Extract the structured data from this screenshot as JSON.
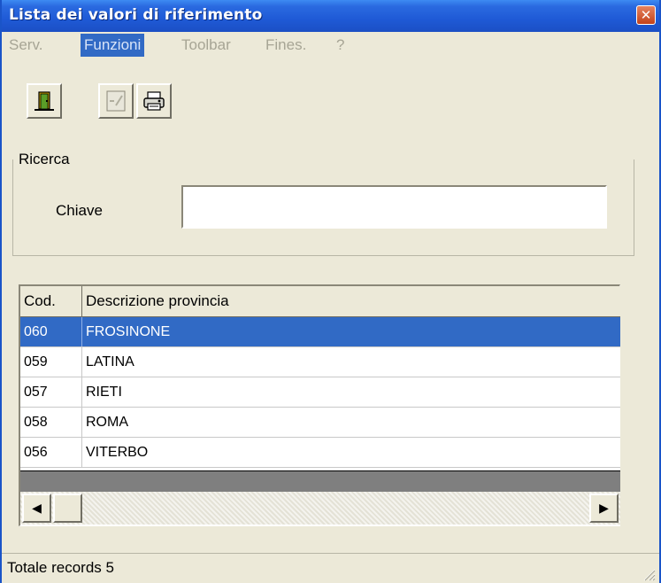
{
  "window": {
    "title": "Lista dei valori di riferimento",
    "close_glyph": "✕"
  },
  "menu": {
    "items": [
      {
        "label": "Serv.",
        "active": false
      },
      {
        "label": "Funzioni",
        "active": true
      },
      {
        "label": "Toolbar",
        "active": false
      },
      {
        "label": "Fines.",
        "active": false
      },
      {
        "label": "?",
        "active": false
      }
    ]
  },
  "toolbar": {
    "buttons": [
      {
        "icon": "exit-door-icon"
      },
      {
        "icon": "clear-icon"
      },
      {
        "icon": "print-icon"
      }
    ]
  },
  "search": {
    "legend": "Ricerca",
    "key_label": "Chiave",
    "key_value": ""
  },
  "table": {
    "columns": [
      "Cod.",
      "Descrizione provincia"
    ],
    "rows": [
      {
        "code": "060",
        "description": "FROSINONE",
        "selected": true
      },
      {
        "code": "059",
        "description": "LATINA",
        "selected": false
      },
      {
        "code": "057",
        "description": "RIETI",
        "selected": false
      },
      {
        "code": "058",
        "description": "ROMA",
        "selected": false
      },
      {
        "code": "056",
        "description": "VITERBO",
        "selected": false
      }
    ]
  },
  "status": {
    "text": "Totale records 5"
  },
  "colors": {
    "titlebar": "#2a6ae0",
    "selection": "#316ac5",
    "face": "#ece9d8"
  }
}
